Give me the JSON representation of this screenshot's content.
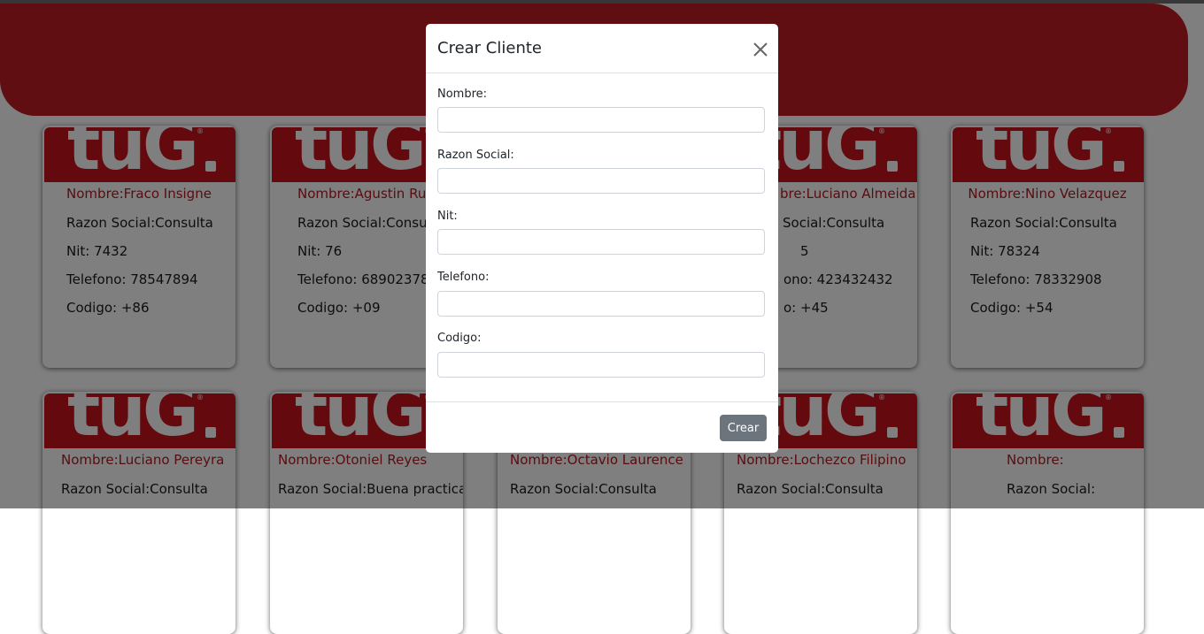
{
  "colors": {
    "brand": "#c11d23",
    "secondary_button": "#6c757d",
    "name_text": "#b01a21"
  },
  "logo": {
    "text": "tuG",
    "icon": "tug-logo"
  },
  "cards": [
    {
      "name": "Nombre:Fraco Insigne",
      "razon": "Razon Social:Consulta",
      "nit": "Nit: 7432",
      "telefono": "Telefono: 78547894",
      "codigo": "Codigo: +86"
    },
    {
      "name": "Nombre:Agustin Ru",
      "razon": "Razon Social:Consul",
      "nit": "Nit: 76",
      "telefono": "Telefono: 68902378",
      "codigo": "Codigo: +09"
    },
    {
      "name": "",
      "razon": "",
      "nit": "",
      "telefono": "",
      "codigo": ""
    },
    {
      "name": "bre:Luciano Almeida",
      "razon": "Social:Consulta",
      "nit": "5",
      "telefono": "ono: 423432432",
      "codigo": "o: +45"
    },
    {
      "name": "Nombre:Nino Velazquez",
      "razon": "Razon Social:Consulta",
      "nit": "Nit: 78324",
      "telefono": "Telefono: 78332908",
      "codigo": "Codigo: +54"
    },
    {
      "name": "Nombre:Luciano Pereyra",
      "razon": "Razon Social:Consulta"
    },
    {
      "name": "Nombre:Otoniel Reyes",
      "razon": "Razon Social:Buena practica"
    },
    {
      "name": "Nombre:Octavio Laurence",
      "razon": "Razon Social:Consulta"
    },
    {
      "name": "Nombre:Lochezco Filipino",
      "razon": "Razon Social:Consulta"
    },
    {
      "name": "Nombre:",
      "razon": "Razon Social:"
    }
  ],
  "modal": {
    "title": "Crear Cliente",
    "close_icon": "close-icon",
    "fields": [
      {
        "label": "Nombre:",
        "value": "",
        "placeholder": ""
      },
      {
        "label": "Razon Social:",
        "value": "",
        "placeholder": ""
      },
      {
        "label": "Nit:",
        "value": "",
        "placeholder": ""
      },
      {
        "label": "Telefono:",
        "value": "",
        "placeholder": ""
      },
      {
        "label": "Codigo:",
        "value": "",
        "placeholder": ""
      }
    ],
    "submit_label": "Crear"
  }
}
